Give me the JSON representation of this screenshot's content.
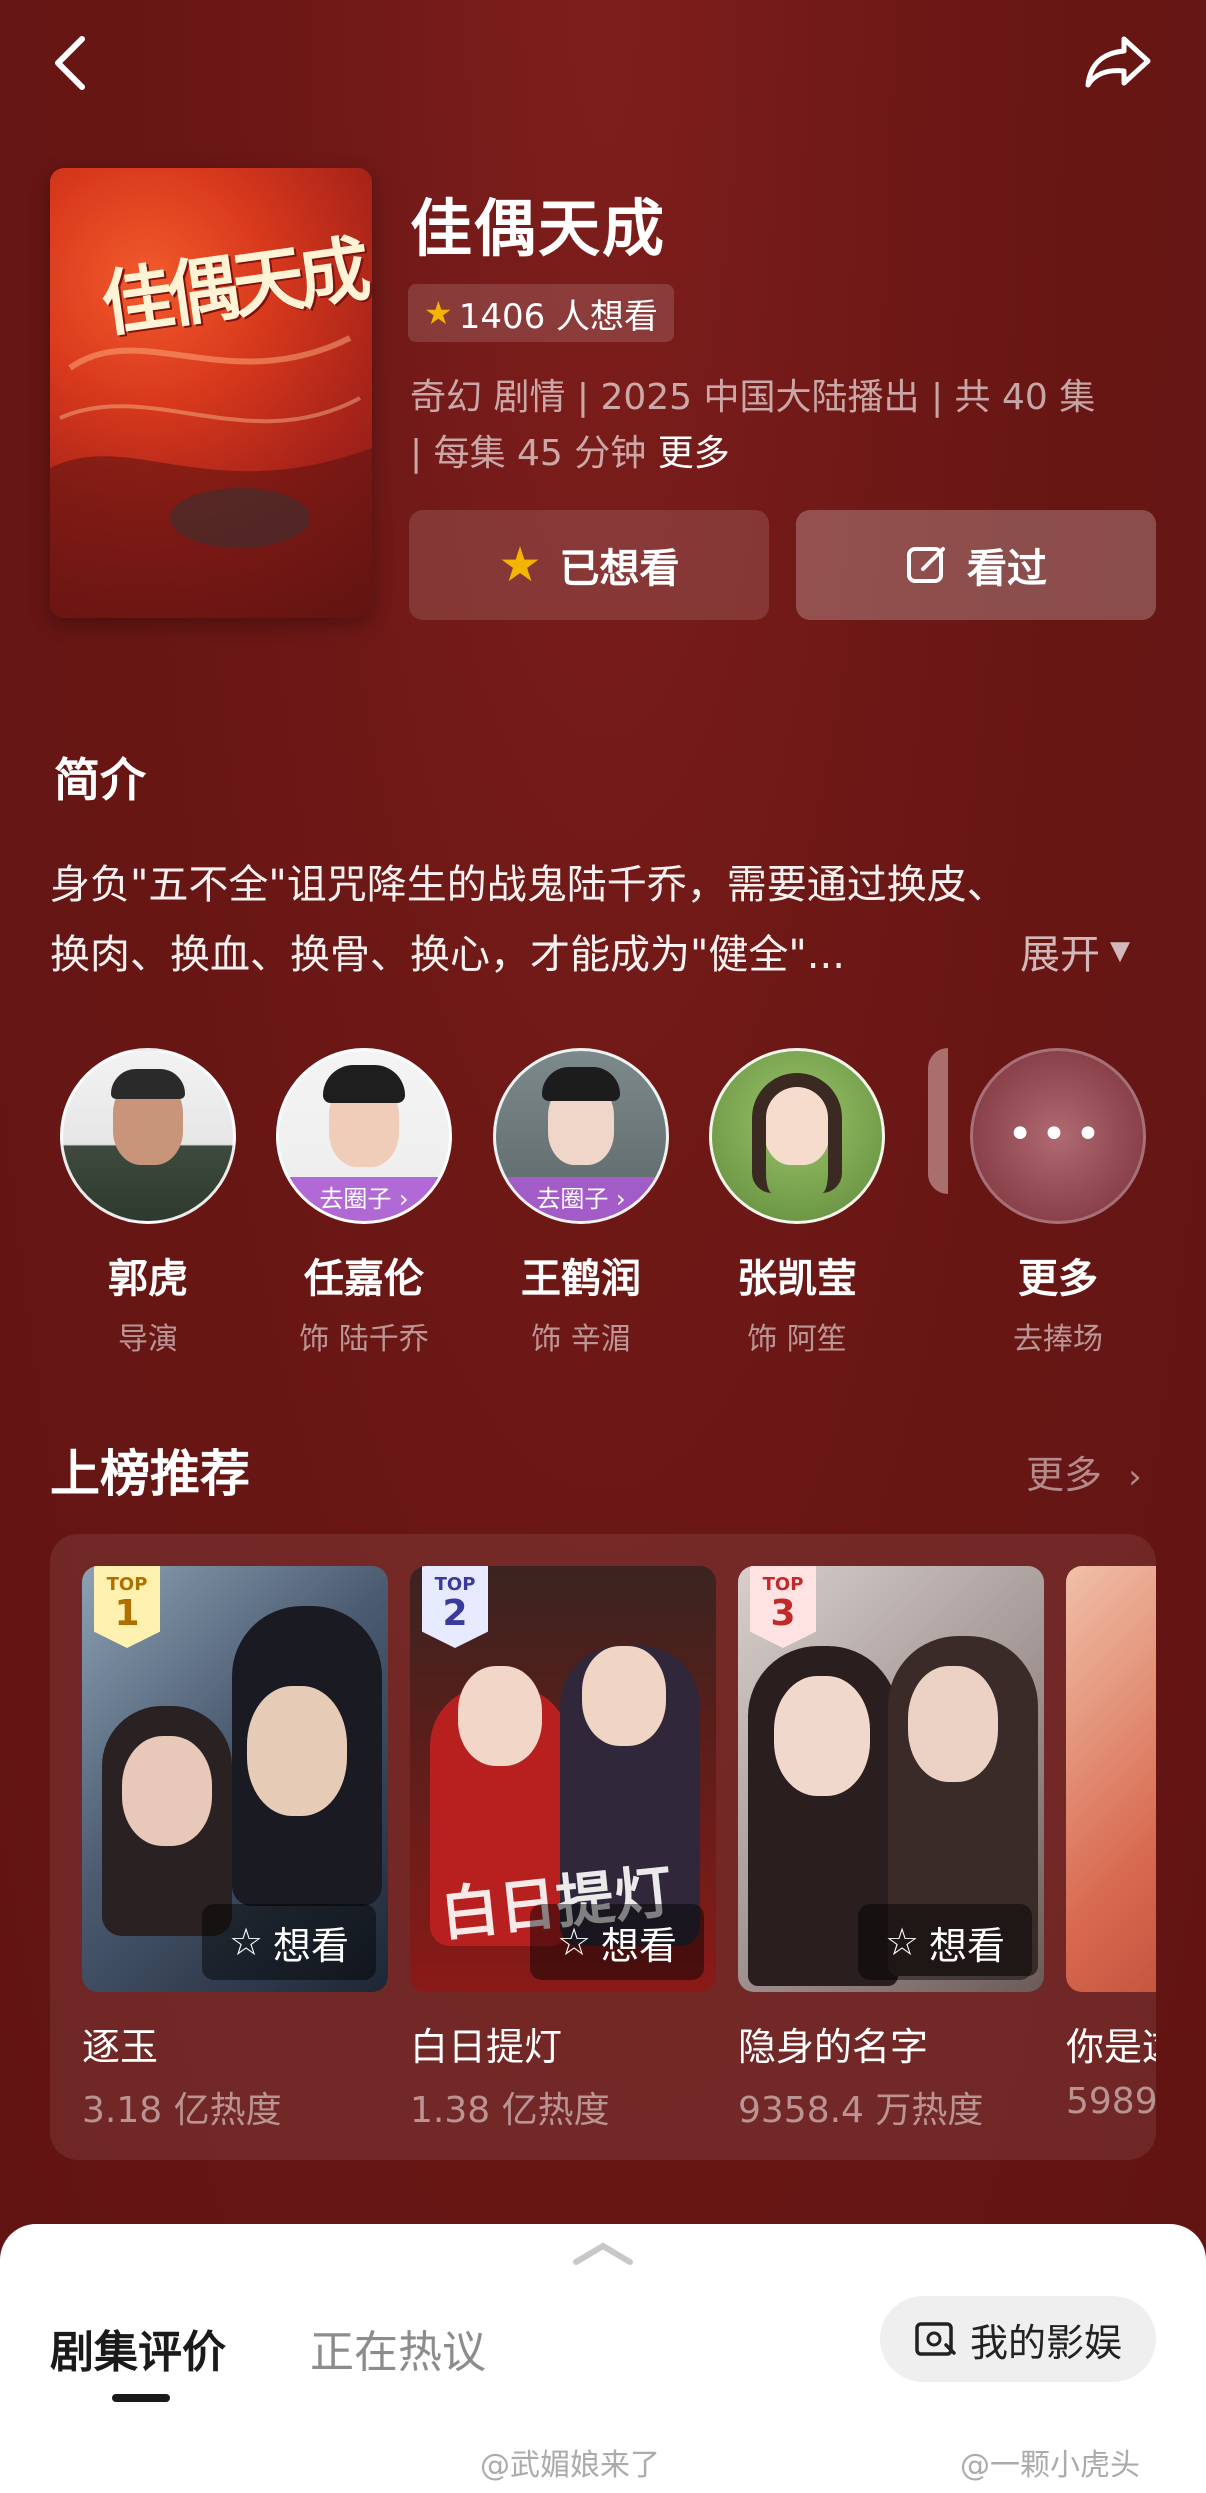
{
  "header": {
    "title": "佳偶天成",
    "want_count": "1406 人想看",
    "meta_line1": "奇幻 剧情 | 2025 中国大陆播出 |  共 40 集",
    "meta_line2": "| 每集 45 分钟",
    "meta_more": "更多",
    "poster_title": "佳偶天成",
    "btn_wanted": "已想看",
    "btn_watched": "看过"
  },
  "intro": {
    "heading": "简介",
    "line1": "身负\"五不全\"诅咒降生的战鬼陆千乔，需要通过换皮、",
    "line2": "换肉、换血、换骨、换心，才能成为\"健全\"...",
    "expand": "展开"
  },
  "cast": [
    {
      "name": "郭虎",
      "role": "导演",
      "tag": ""
    },
    {
      "name": "任嘉伦",
      "role": "饰 陆千乔",
      "tag": "去圈子 ›"
    },
    {
      "name": "王鹤润",
      "role": "饰 辛湄",
      "tag": "去圈子 ›"
    },
    {
      "name": "张凯莹",
      "role": "饰 阿笙",
      "tag": ""
    },
    {
      "name": "更多",
      "role": "去捧场",
      "tag": ""
    }
  ],
  "ranking": {
    "title": "上榜推荐",
    "more": "更多",
    "want_label": "想看",
    "items": [
      {
        "rank_label": "TOP",
        "rank": "1",
        "name": "逐玉",
        "heat": "3.18 亿热度"
      },
      {
        "rank_label": "TOP",
        "rank": "2",
        "name": "白日提灯",
        "heat": "1.38 亿热度"
      },
      {
        "rank_label": "TOP",
        "rank": "3",
        "name": "隐身的名字",
        "heat": "9358.4 万热度"
      },
      {
        "rank_label": "",
        "rank": "",
        "name": "你是这",
        "heat": "5989"
      }
    ]
  },
  "bottom_sheet": {
    "tab_active": "剧集评价",
    "tab_inactive": "正在热议",
    "my_button": "我的影娱"
  },
  "watermarks": [
    "@武媚娘来了",
    "@一颗小虎头"
  ],
  "colors": {
    "background": "#6a1715",
    "star": "#f5b400",
    "accent_purple": "#aa5ad2"
  }
}
